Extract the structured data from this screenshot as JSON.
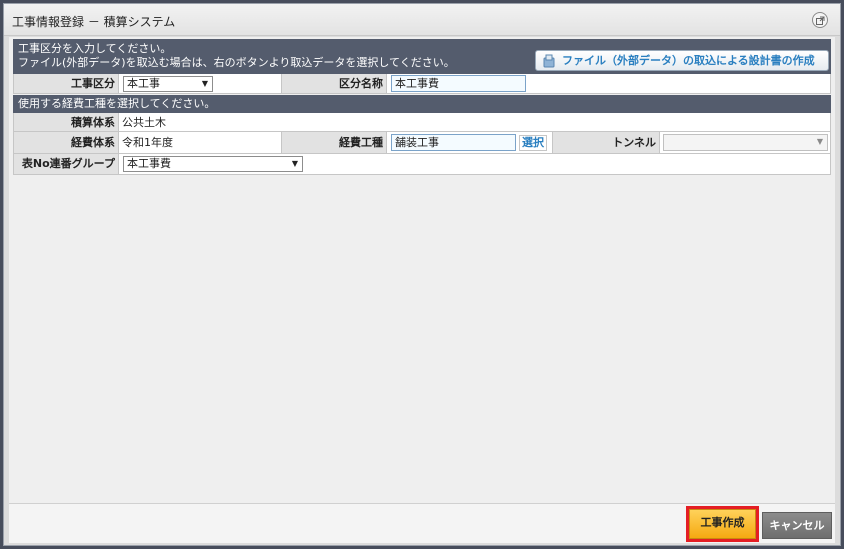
{
  "window": {
    "title": "工事情報登録 － 積算システム"
  },
  "instructions": {
    "line1": "工事区分を入力してください。",
    "line2": "ファイル(外部データ)を取込む場合は、右のボタンより取込データを選択してください。",
    "file_button": "ファイル（外部データ）の取込による設計書の作成"
  },
  "form": {
    "koji_kubun_label": "工事区分",
    "koji_kubun_value": "本工事",
    "kubun_meisho_label": "区分名称",
    "kubun_meisho_value": "本工事費",
    "expense_instruction": "使用する経費工種を選択してください。",
    "sekisan_taikei_label": "積算体系",
    "sekisan_taikei_value": "公共土木",
    "keihi_taikei_label": "経費体系",
    "keihi_taikei_value": "令和1年度",
    "keihi_koshu_label": "経費工種",
    "keihi_koshu_value": "舗装工事",
    "select_link": "選択",
    "tunnel_label": "トンネル",
    "tunnel_value": "",
    "table_group_label": "表No連番グループ",
    "table_group_value": "本工事費"
  },
  "footer": {
    "create_button": "工事作成",
    "cancel_button": "キャンセル"
  },
  "icons": {
    "popout": "popout-icon",
    "file_import": "file-import-icon",
    "dropdown": "chevron-down-icon"
  }
}
